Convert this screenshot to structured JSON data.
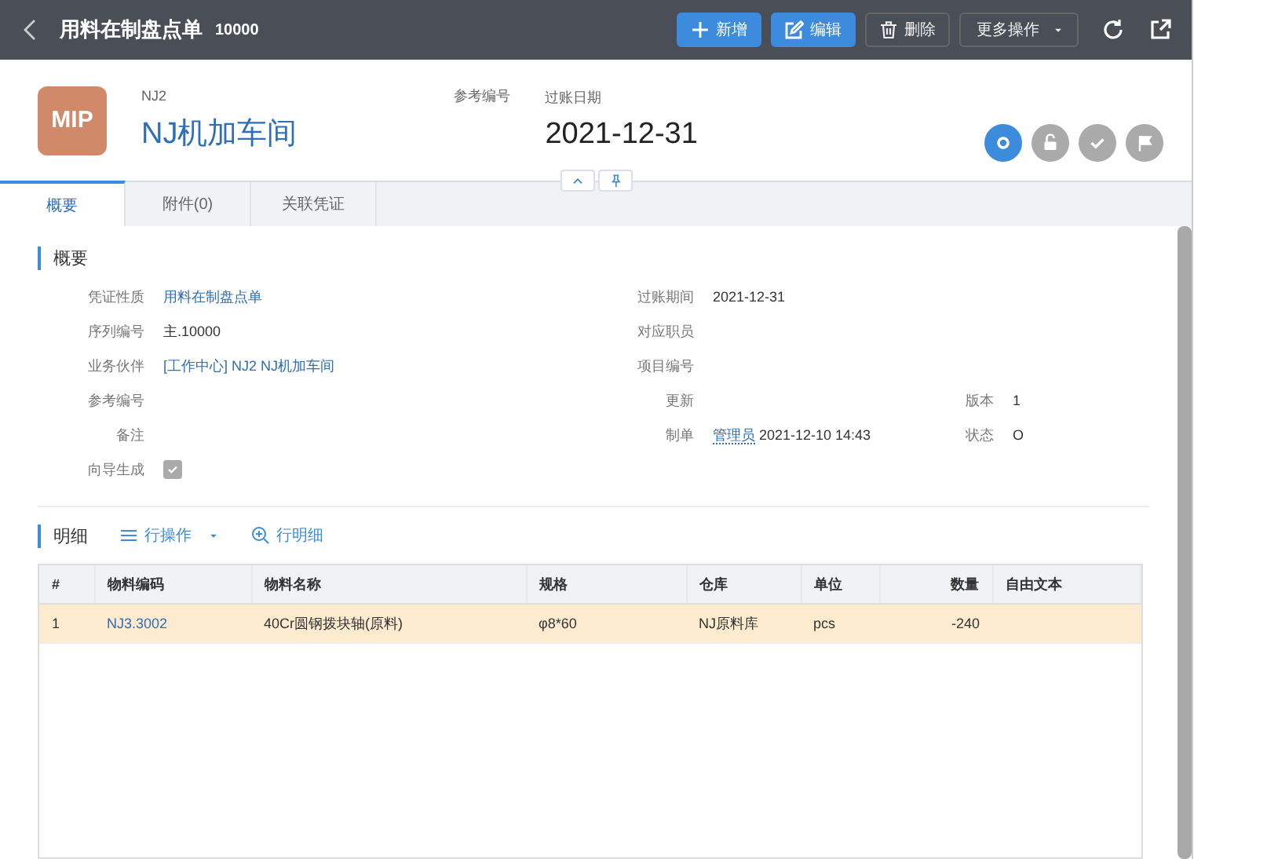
{
  "top_bar": {
    "title": "用料在制盘点单",
    "number": "10000",
    "buttons": [
      {
        "kind": "add",
        "label": "新增"
      },
      {
        "kind": "edit",
        "label": "编辑"
      },
      {
        "kind": "delete",
        "label": "删除"
      },
      {
        "kind": "more",
        "label": "更多操作"
      }
    ],
    "tools": [
      {
        "kind": "refresh"
      },
      {
        "kind": "external"
      }
    ]
  },
  "header": {
    "avatar": "MIP",
    "code": "NJ2",
    "name": "NJ机加车间",
    "ref_label": "参考编号",
    "date_label": "过账日期",
    "date": "2021-12-31",
    "steps": [
      {
        "kind": "open",
        "selected": true
      },
      {
        "kind": "lock",
        "selected": false
      },
      {
        "kind": "check",
        "selected": false
      },
      {
        "kind": "flag",
        "selected": false
      }
    ]
  },
  "tabs": [
    {
      "label": "概要",
      "selected": true
    },
    {
      "label": "附件(0)",
      "selected": false
    },
    {
      "label": "关联凭证",
      "selected": false
    }
  ],
  "overview": {
    "title": "概要",
    "rows": [
      {
        "left": {
          "label": "凭证性质",
          "kind": "link",
          "value": "用料在制盘点单"
        },
        "middle": {
          "label": "过账期间",
          "kind": "text",
          "value": "2021-12-31"
        }
      },
      {
        "left": {
          "label": "序列编号",
          "kind": "text",
          "value": "主.10000"
        },
        "middle": {
          "label": "对应职员",
          "kind": "text"
        }
      },
      {
        "left": {
          "label": "业务伙伴",
          "kind": "link",
          "value": "[工作中心] NJ2 NJ机加车间"
        },
        "middle": {
          "label": "项目编号",
          "kind": "text"
        }
      },
      {
        "left": {
          "label": "参考编号",
          "kind": "text"
        },
        "middle": {
          "label": "更新",
          "kind": "text"
        },
        "right": {
          "label": "版本",
          "kind": "text",
          "value": "1"
        }
      },
      {
        "left": {
          "label": "备注",
          "kind": "text"
        },
        "middle": {
          "label": "制单",
          "kind": "user",
          "user": "管理员",
          "value": "2021-12-10 14:43"
        },
        "right": {
          "label": "状态",
          "kind": "text",
          "value": "O"
        }
      },
      {
        "left": {
          "label": "向导生成",
          "kind": "checkbox",
          "checked": true
        }
      }
    ]
  },
  "detail": {
    "title": "明细",
    "actions": [
      {
        "kind": "menu",
        "label": "行操作"
      },
      {
        "kind": "zoom",
        "label": "行明细"
      }
    ],
    "columns": [
      "#",
      "物料编码",
      "物料名称",
      "规格",
      "仓库",
      "单位",
      "数量",
      "自由文本"
    ],
    "rows": [
      {
        "selected": true,
        "cells": [
          "1",
          "NJ3.3002",
          "40Cr圆钢拨块轴(原料)",
          "φ8*60",
          "NJ原料库",
          "pcs",
          "-240"
        ]
      }
    ]
  }
}
